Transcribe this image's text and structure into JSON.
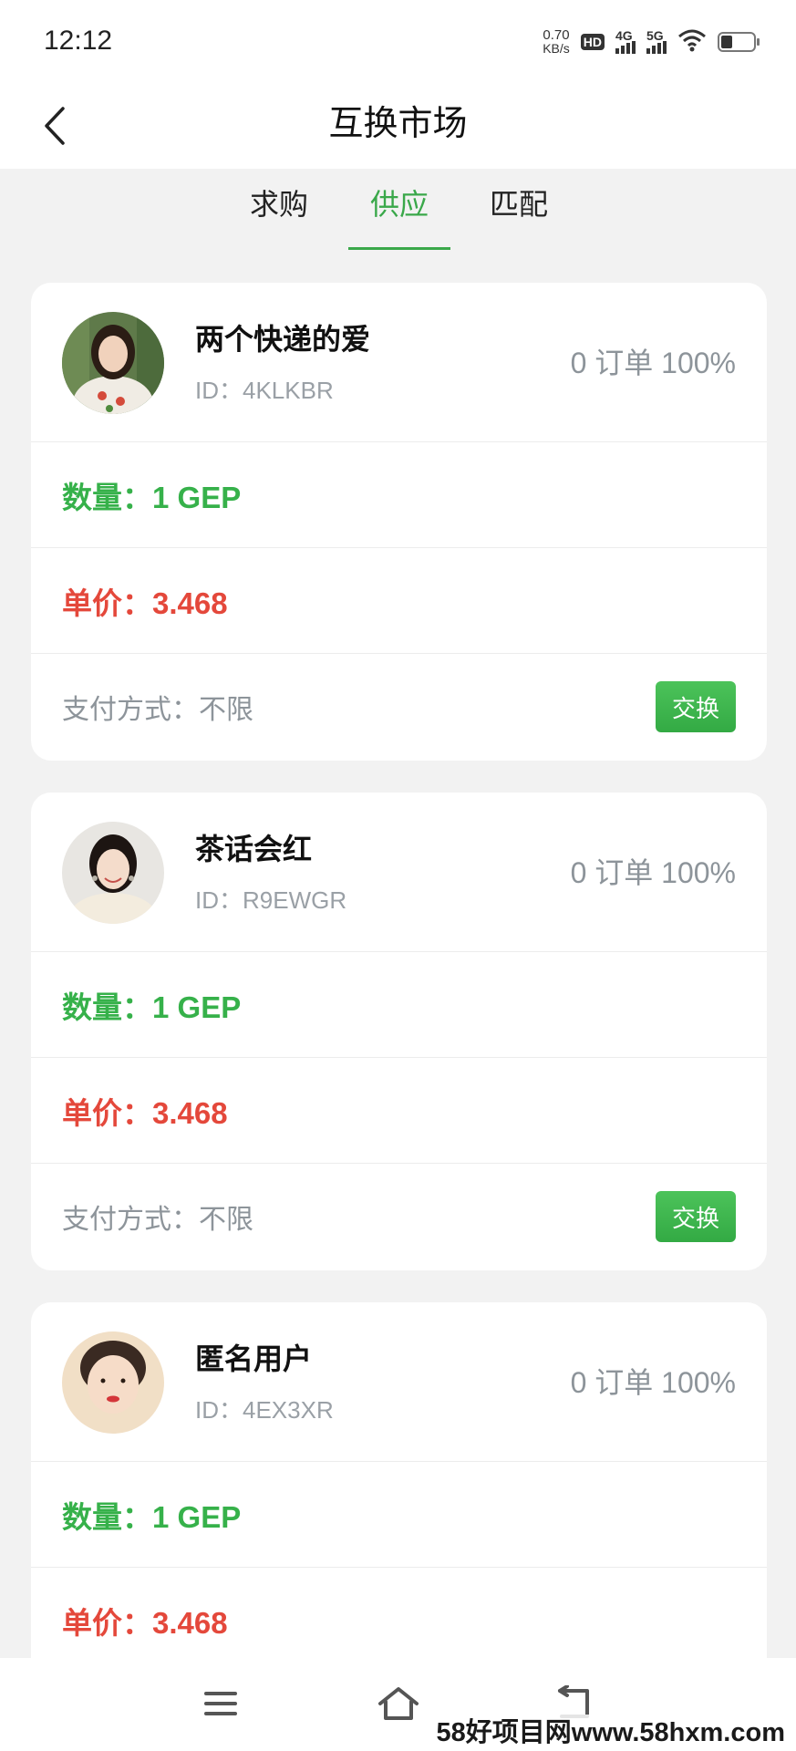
{
  "status_bar": {
    "time": "12:12",
    "net_speed_value": "0.70",
    "net_speed_unit": "KB/s",
    "hd_label": "HD",
    "signal_1_label": "4G",
    "signal_2_label": "5G",
    "icons": [
      "wifi-icon",
      "battery-icon"
    ]
  },
  "header": {
    "title": "互换市场",
    "back_icon": "chevron-left-icon"
  },
  "tabs": [
    {
      "label": "求购",
      "active": false
    },
    {
      "label": "供应",
      "active": true
    },
    {
      "label": "匹配",
      "active": false
    }
  ],
  "listings": [
    {
      "name": "两个快递的爱",
      "id_text": "ID：4KLKBR",
      "stats": "0 订单 100%",
      "quantity": "数量：1 GEP",
      "unit_price": "单价：3.468",
      "payment": "支付方式：不限",
      "button_label": "交换"
    },
    {
      "name": "茶话会红",
      "id_text": "ID：R9EWGR",
      "stats": "0 订单 100%",
      "quantity": "数量：1 GEP",
      "unit_price": "单价：3.468",
      "payment": "支付方式：不限",
      "button_label": "交换"
    },
    {
      "name": "匿名用户",
      "id_text": "ID：4EX3XR",
      "stats": "0 订单 100%",
      "quantity": "数量：1 GEP",
      "unit_price": "单价：3.468"
    }
  ],
  "bottom_nav": {
    "icons": [
      "menu-icon",
      "home-icon",
      "back-icon"
    ]
  },
  "watermark": "58好项目网www.58hxm.com",
  "colors": {
    "accent_green": "#3aa84a",
    "price_red": "#e4483b",
    "background": "#f2f2f2"
  }
}
